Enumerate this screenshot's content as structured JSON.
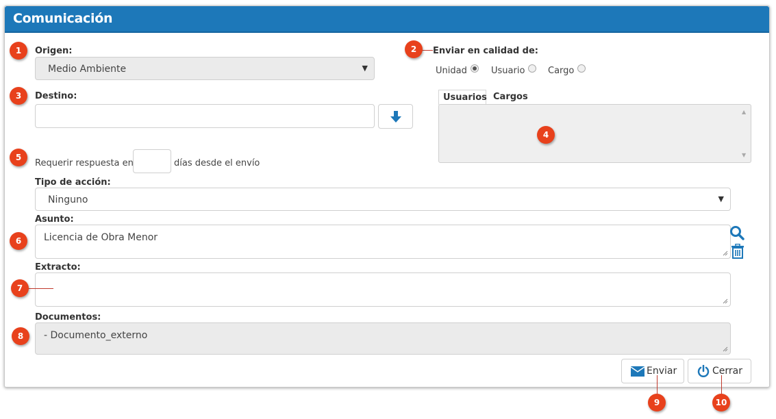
{
  "header": {
    "title": "Comunicación"
  },
  "origen": {
    "label": "Origen:",
    "value": "Medio Ambiente"
  },
  "enviar": {
    "label": "Enviar en calidad de:",
    "options": [
      {
        "label": "Unidad",
        "selected": true
      },
      {
        "label": "Usuario",
        "selected": false
      },
      {
        "label": "Cargo",
        "selected": false
      }
    ]
  },
  "destino": {
    "label": "Destino:",
    "value": ""
  },
  "tabs": [
    "Usuarios",
    "Cargos"
  ],
  "respuesta": {
    "prefix": "Requerir respuesta en",
    "value": "",
    "suffix": "días desde el envío"
  },
  "tipo_accion": {
    "label": "Tipo de acción:",
    "value": "Ninguno"
  },
  "asunto": {
    "label": "Asunto:",
    "value": "Licencia de Obra Menor"
  },
  "extracto": {
    "label": "Extracto:",
    "value": ""
  },
  "documentos": {
    "label": "Documentos:",
    "value": "- Documento_externo"
  },
  "buttons": {
    "send": "Enviar",
    "close": "Cerrar"
  },
  "badges": [
    "1",
    "2",
    "3",
    "4",
    "5",
    "6",
    "7",
    "8",
    "9",
    "10"
  ],
  "colors": {
    "header": "#1d78b9",
    "badge": "#e8411c",
    "icon": "#1d78b9"
  }
}
